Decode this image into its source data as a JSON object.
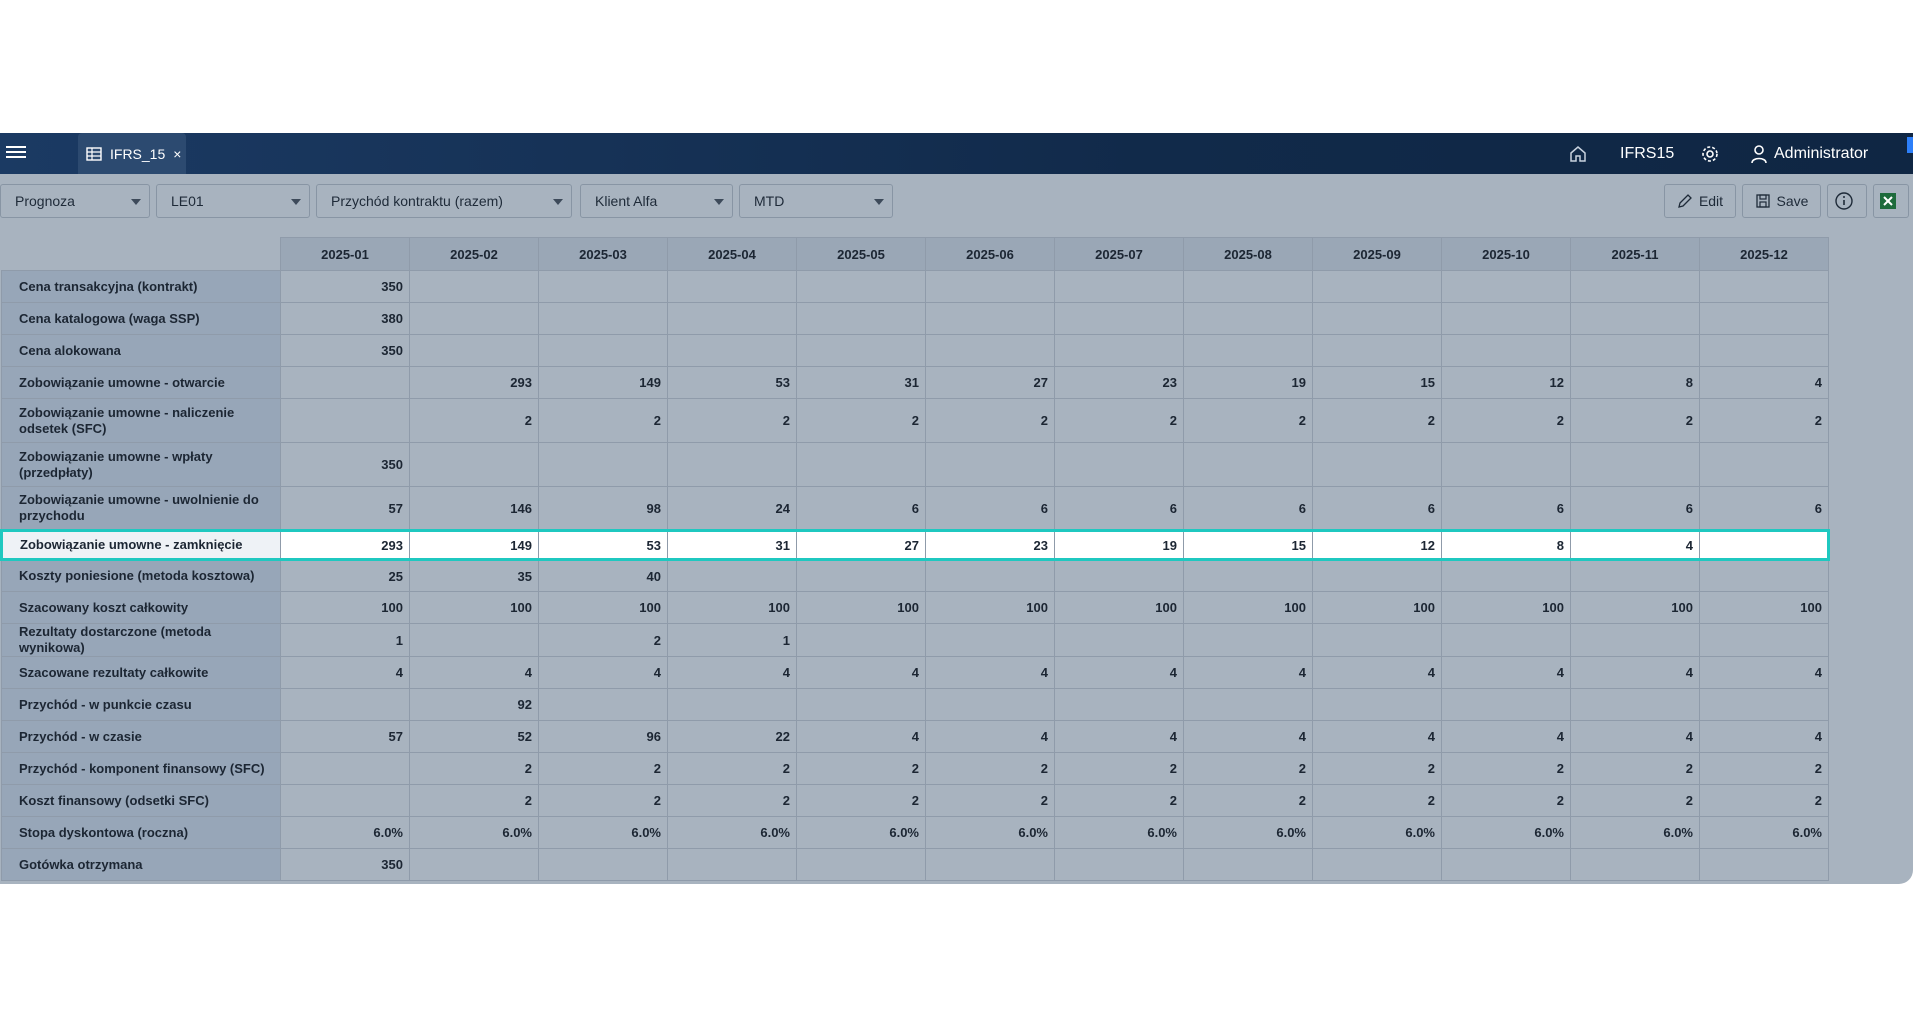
{
  "topbar": {
    "tab_label": "IFRS_15",
    "tab_close": "×",
    "app_name": "IFRS15",
    "user_label": "Administrator"
  },
  "filters": {
    "scenario": "Prognoza",
    "entity": "LE01",
    "measure": "Przychód kontraktu (razem)",
    "customer": "Klient Alfa",
    "period_type": "MTD"
  },
  "toolbar": {
    "edit_label": "Edit",
    "save_label": "Save"
  },
  "grid": {
    "columns": [
      "2025-01",
      "2025-02",
      "2025-03",
      "2025-04",
      "2025-05",
      "2025-06",
      "2025-07",
      "2025-08",
      "2025-09",
      "2025-10",
      "2025-11",
      "2025-12"
    ],
    "highlighted_row": "Zobowiązanie umowne - zamknięcie",
    "rows": [
      {
        "label": "Cena transakcyjna (kontrakt)",
        "values": [
          "350",
          "",
          "",
          "",
          "",
          "",
          "",
          "",
          "",
          "",
          "",
          ""
        ]
      },
      {
        "label": "Cena katalogowa (waga SSP)",
        "values": [
          "380",
          "",
          "",
          "",
          "",
          "",
          "",
          "",
          "",
          "",
          "",
          ""
        ]
      },
      {
        "label": "Cena alokowana",
        "values": [
          "350",
          "",
          "",
          "",
          "",
          "",
          "",
          "",
          "",
          "",
          "",
          ""
        ]
      },
      {
        "label": "Zobowiązanie umowne - otwarcie",
        "values": [
          "",
          "293",
          "149",
          "53",
          "31",
          "27",
          "23",
          "19",
          "15",
          "12",
          "8",
          "4"
        ]
      },
      {
        "label": "Zobowiązanie umowne - naliczenie odsetek (SFC)",
        "values": [
          "",
          "2",
          "2",
          "2",
          "2",
          "2",
          "2",
          "2",
          "2",
          "2",
          "2",
          "2"
        ]
      },
      {
        "label": "Zobowiązanie umowne - wpłaty (przedpłaty)",
        "values": [
          "350",
          "",
          "",
          "",
          "",
          "",
          "",
          "",
          "",
          "",
          "",
          ""
        ]
      },
      {
        "label": "Zobowiązanie umowne - uwolnienie do przychodu",
        "values": [
          "57",
          "146",
          "98",
          "24",
          "6",
          "6",
          "6",
          "6",
          "6",
          "6",
          "6",
          "6"
        ]
      },
      {
        "label": "Zobowiązanie umowne - zamknięcie",
        "values": [
          "293",
          "149",
          "53",
          "31",
          "27",
          "23",
          "19",
          "15",
          "12",
          "8",
          "4",
          ""
        ]
      },
      {
        "label": "Koszty poniesione (metoda kosztowa)",
        "values": [
          "25",
          "35",
          "40",
          "",
          "",
          "",
          "",
          "",
          "",
          "",
          "",
          ""
        ]
      },
      {
        "label": "Szacowany koszt całkowity",
        "values": [
          "100",
          "100",
          "100",
          "100",
          "100",
          "100",
          "100",
          "100",
          "100",
          "100",
          "100",
          "100"
        ]
      },
      {
        "label": "Rezultaty dostarczone (metoda wynikowa)",
        "values": [
          "1",
          "",
          "2",
          "1",
          "",
          "",
          "",
          "",
          "",
          "",
          "",
          ""
        ]
      },
      {
        "label": "Szacowane rezultaty całkowite",
        "values": [
          "4",
          "4",
          "4",
          "4",
          "4",
          "4",
          "4",
          "4",
          "4",
          "4",
          "4",
          "4"
        ]
      },
      {
        "label": "Przychód - w punkcie czasu",
        "values": [
          "",
          "92",
          "",
          "",
          "",
          "",
          "",
          "",
          "",
          "",
          "",
          ""
        ]
      },
      {
        "label": "Przychód - w czasie",
        "values": [
          "57",
          "52",
          "96",
          "22",
          "4",
          "4",
          "4",
          "4",
          "4",
          "4",
          "4",
          "4"
        ]
      },
      {
        "label": "Przychód - komponent finansowy (SFC)",
        "values": [
          "",
          "2",
          "2",
          "2",
          "2",
          "2",
          "2",
          "2",
          "2",
          "2",
          "2",
          "2"
        ]
      },
      {
        "label": "Koszt finansowy (odsetki SFC)",
        "values": [
          "",
          "2",
          "2",
          "2",
          "2",
          "2",
          "2",
          "2",
          "2",
          "2",
          "2",
          "2"
        ]
      },
      {
        "label": "Stopa dyskontowa (roczna)",
        "values": [
          "6.0%",
          "6.0%",
          "6.0%",
          "6.0%",
          "6.0%",
          "6.0%",
          "6.0%",
          "6.0%",
          "6.0%",
          "6.0%",
          "6.0%",
          "6.0%"
        ]
      },
      {
        "label": "Gotówka otrzymana",
        "values": [
          "350",
          "",
          "",
          "",
          "",
          "",
          "",
          "",
          "",
          "",
          "",
          ""
        ]
      }
    ]
  },
  "colors": {
    "topbar": "#112a4a",
    "highlight_border": "#1fc8c0",
    "background": "#a8b3bf"
  }
}
